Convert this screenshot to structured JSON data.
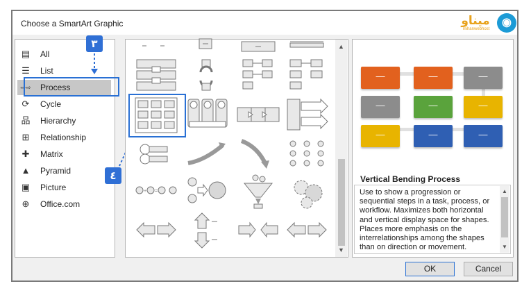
{
  "dialog": {
    "title": "Choose a SmartArt Graphic"
  },
  "logo": {
    "text": "میناو",
    "sub": "mihanwebhost"
  },
  "categories": [
    {
      "label": "All",
      "icon": "all-icon"
    },
    {
      "label": "List",
      "icon": "list-icon"
    },
    {
      "label": "Process",
      "icon": "process-icon"
    },
    {
      "label": "Cycle",
      "icon": "cycle-icon"
    },
    {
      "label": "Hierarchy",
      "icon": "hierarchy-icon"
    },
    {
      "label": "Relationship",
      "icon": "relationship-icon"
    },
    {
      "label": "Matrix",
      "icon": "matrix-icon"
    },
    {
      "label": "Pyramid",
      "icon": "pyramid-icon"
    },
    {
      "label": "Picture",
      "icon": "picture-icon"
    },
    {
      "label": "Office.com",
      "icon": "globe-icon"
    }
  ],
  "selected_category": "Process",
  "annotations": {
    "step3": "٣",
    "step4": "٤"
  },
  "preview": {
    "title": "Vertical Bending Process",
    "description": "Use to show a progression or sequential steps in a task, process, or workflow. Maximizes both horizontal and vertical display space for shapes. Places more emphasis on the interrelationships among the shapes than on direction or movement.",
    "box_text": "—",
    "colors": {
      "orange": "#e2611e",
      "red": "#e2611e",
      "gray": "#8c8c8c",
      "green": "#5aa33c",
      "gold": "#e8b400",
      "blue": "#2f5fb3"
    }
  },
  "buttons": {
    "ok": "OK",
    "cancel": "Cancel"
  }
}
